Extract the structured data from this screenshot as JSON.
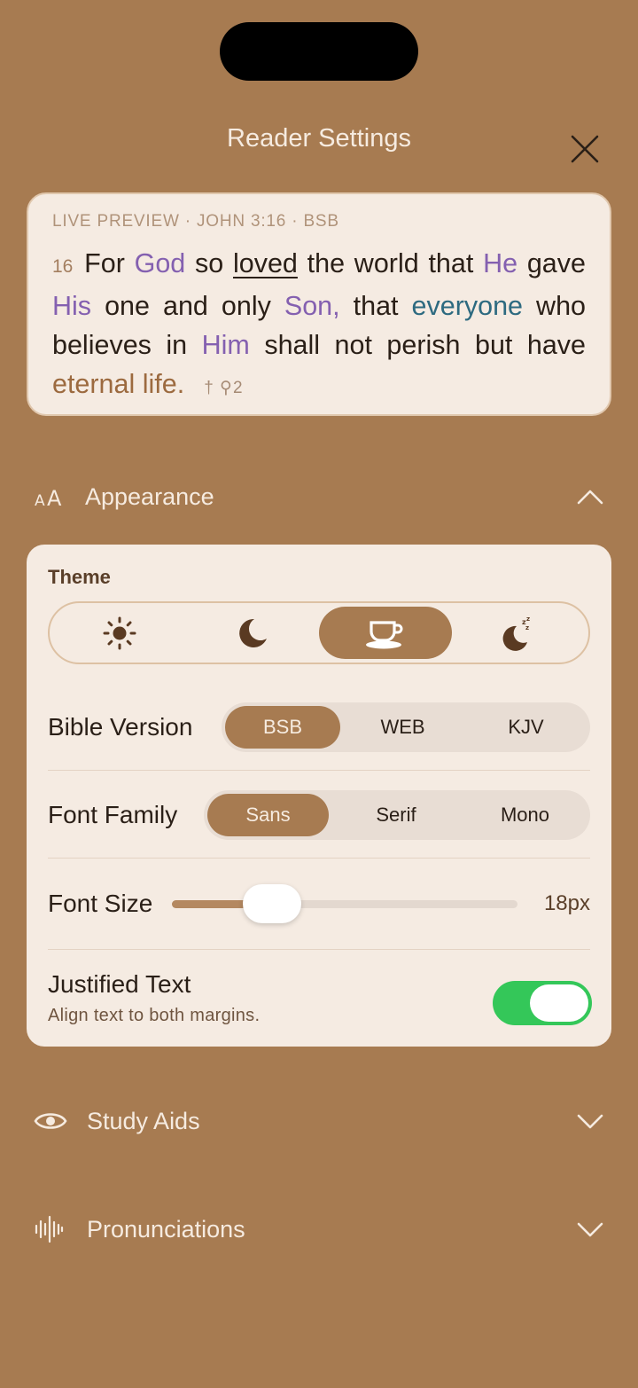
{
  "header": {
    "title": "Reader Settings"
  },
  "preview": {
    "label": "LIVE PREVIEW · JOHN 3:16 · BSB",
    "verse_number": "16",
    "text": {
      "t1": "For ",
      "god": "God",
      "t2": " so ",
      "loved": "loved",
      "t3": " the world that ",
      "he": "He",
      "t4": " gave ",
      "his": "His",
      "t5": " one and only ",
      "son": "Son,",
      "t6": " that ",
      "everyone": "everyone",
      "t7": " who believes in ",
      "him": "Him",
      "t8": " shall not perish but have ",
      "eternal": "eternal life."
    },
    "marks": "† ⚲2"
  },
  "appearance": {
    "label": "Appearance",
    "theme_label": "Theme",
    "themes": [
      {
        "name": "light",
        "icon": "sun-icon"
      },
      {
        "name": "dark",
        "icon": "moon-icon"
      },
      {
        "name": "sepia",
        "icon": "coffee-cup-icon",
        "active": true
      },
      {
        "name": "night",
        "icon": "moon-sleep-icon"
      }
    ],
    "bible_version": {
      "label": "Bible Version",
      "options": [
        "BSB",
        "WEB",
        "KJV"
      ],
      "selected": "BSB"
    },
    "font_family": {
      "label": "Font Family",
      "options": [
        "Sans",
        "Serif",
        "Mono"
      ],
      "selected": "Sans"
    },
    "font_size": {
      "label": "Font Size",
      "value": "18px",
      "level": 0.29
    },
    "justified": {
      "title": "Justified Text",
      "subtitle": "Align text to both margins.",
      "on": true
    }
  },
  "sections": {
    "study_aids": "Study Aids",
    "pronunciations": "Pronunciations"
  },
  "colors": {
    "background": "#a77b51",
    "card": "#f5ebe2",
    "accent": "#a77b51",
    "toggle_on": "#34c759",
    "highlight_purple": "#8460b0",
    "highlight_teal": "#2d6a80"
  }
}
